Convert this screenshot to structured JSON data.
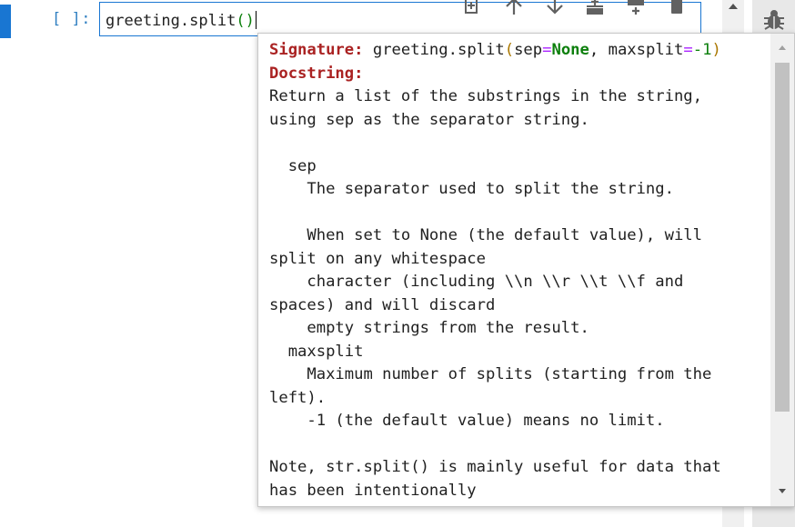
{
  "cell": {
    "prompt": "[ ]:",
    "code_name": "greeting",
    "code_dot": ".",
    "code_func": "split",
    "code_paren": "()"
  },
  "toolbar": {
    "icons": [
      "duplicate-icon",
      "move-up-icon",
      "move-down-icon",
      "insert-above-icon",
      "insert-below-icon",
      "delete-icon"
    ]
  },
  "sidebar": {
    "icon": "debugger-bug-icon"
  },
  "tooltip": {
    "signature_label": "Signature:",
    "signature_name": "greeting.split",
    "signature_open": "(",
    "sig_sep": "sep",
    "sig_eq1": "=",
    "sig_none": "None",
    "sig_comma": ", ",
    "sig_maxsplit": "maxsplit",
    "sig_eq2": "=",
    "sig_neg1": "-1",
    "signature_close": ")",
    "docstring_label": "Docstring:",
    "doc_lines": [
      "Return a list of the substrings in the string,",
      "using sep as the separator string.",
      "",
      "  sep",
      "    The separator used to split the string.",
      "",
      "    When set to None (the default value), will",
      "split on any whitespace",
      "    character (including \\\\n \\\\r \\\\t \\\\f and",
      "spaces) and will discard",
      "    empty strings from the result.",
      "  maxsplit",
      "    Maximum number of splits (starting from the",
      "left).",
      "    -1 (the default value) means no limit.",
      "",
      "Note, str.split() is mainly useful for data that",
      "has been intentionally"
    ]
  }
}
